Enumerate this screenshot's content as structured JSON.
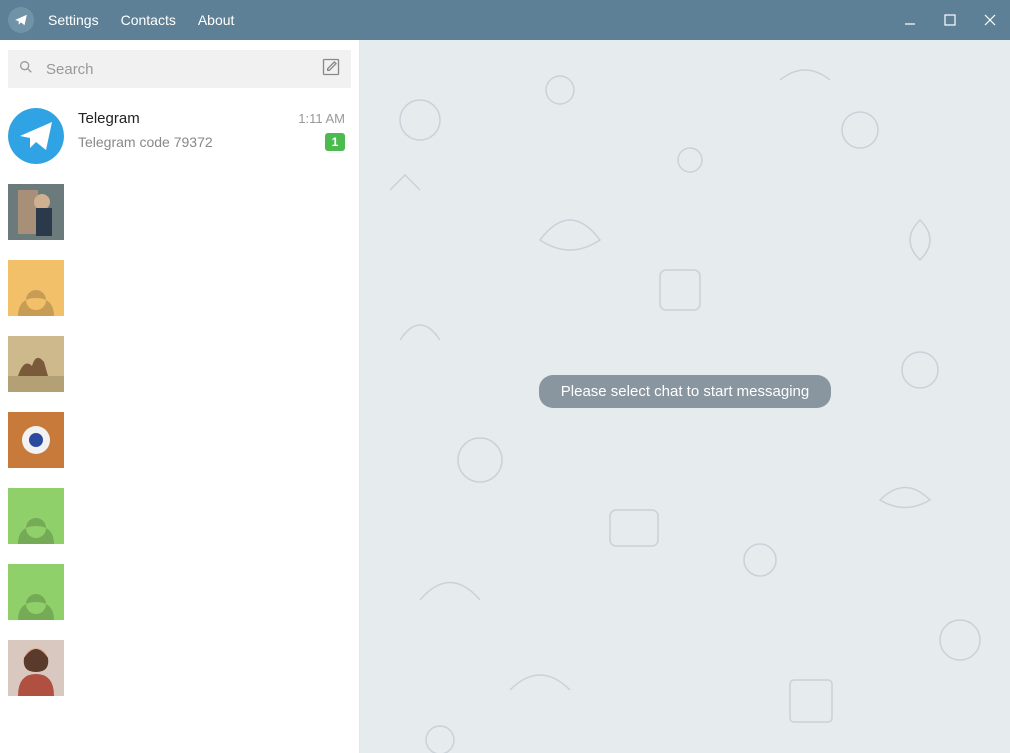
{
  "titlebar": {
    "menu": {
      "settings": "Settings",
      "contacts": "Contacts",
      "about": "About"
    }
  },
  "search": {
    "placeholder": "Search"
  },
  "chats": [
    {
      "name": "Telegram",
      "time": "1:11 AM",
      "preview": "Telegram code 79372",
      "unread": "1",
      "avatar_type": "telegram"
    },
    {
      "name": "",
      "time": "",
      "preview": "",
      "unread": "",
      "avatar_type": "photo1"
    },
    {
      "name": "",
      "time": "",
      "preview": "",
      "unread": "",
      "avatar_type": "silhouette_orange"
    },
    {
      "name": "",
      "time": "",
      "preview": "",
      "unread": "",
      "avatar_type": "photo_camel"
    },
    {
      "name": "",
      "time": "",
      "preview": "",
      "unread": "",
      "avatar_type": "photo_food"
    },
    {
      "name": "",
      "time": "",
      "preview": "",
      "unread": "",
      "avatar_type": "silhouette_green"
    },
    {
      "name": "",
      "time": "",
      "preview": "",
      "unread": "",
      "avatar_type": "silhouette_green"
    },
    {
      "name": "",
      "time": "",
      "preview": "",
      "unread": "",
      "avatar_type": "photo_person2"
    }
  ],
  "main": {
    "empty_hint": "Please select chat to start messaging"
  }
}
